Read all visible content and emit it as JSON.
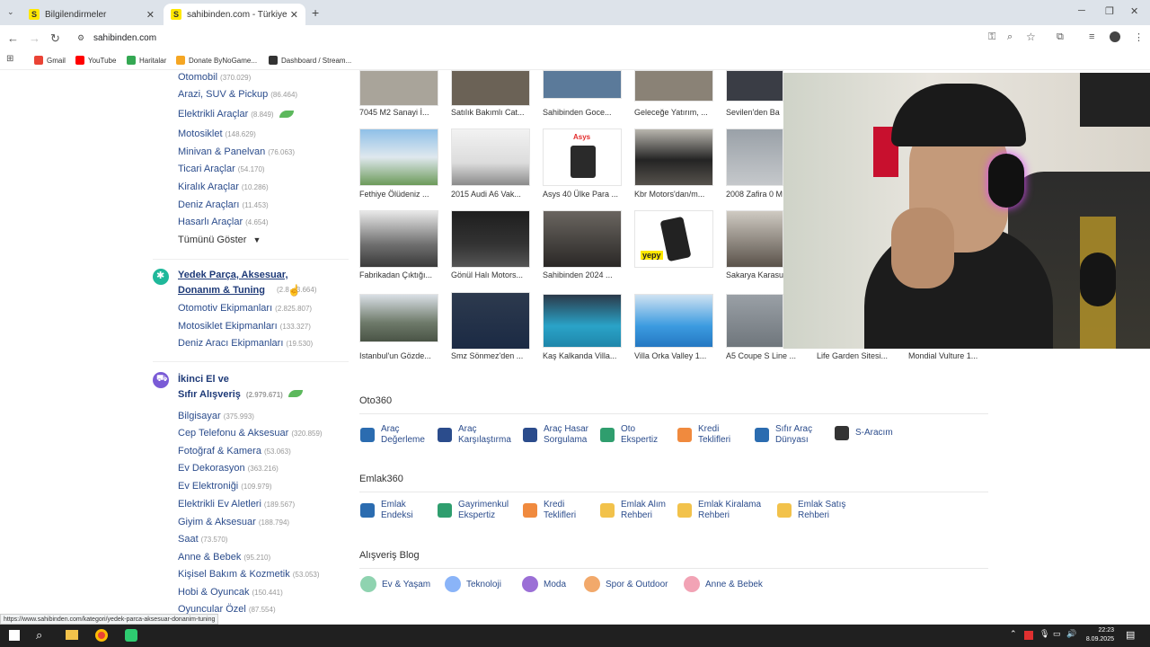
{
  "browser": {
    "tabs": [
      {
        "title": "Bilgilendirmeler",
        "favicon": "S"
      },
      {
        "title": "sahibinden.com - Türkiye'nin O",
        "favicon": "S"
      }
    ],
    "new_tab": "+",
    "url": "sahibinden.com",
    "bookmarks": [
      {
        "label": "Gmail",
        "color": "#ea4335"
      },
      {
        "label": "YouTube",
        "color": "#ff0000"
      },
      {
        "label": "Haritalar",
        "color": "#34a853"
      },
      {
        "label": "Donate ByNoGame...",
        "color": "#f5a623"
      },
      {
        "label": "Dashboard / Stream...",
        "color": "#333333"
      }
    ]
  },
  "vehicles": [
    {
      "name": "Otomobil",
      "count": "(370.029)"
    },
    {
      "name": "Arazi, SUV & Pickup",
      "count": "(86.464)"
    },
    {
      "name": "Elektrikli Araçlar",
      "count": "(8.849)"
    },
    {
      "name": "Motosiklet",
      "count": "(148.629)"
    },
    {
      "name": "Minivan & Panelvan",
      "count": "(76.063)"
    },
    {
      "name": "Ticari Araçlar",
      "count": "(54.170)"
    },
    {
      "name": "Kiralık Araçlar",
      "count": "(10.286)"
    },
    {
      "name": "Deniz Araçları",
      "count": "(11.453)"
    },
    {
      "name": "Hasarlı Araçlar",
      "count": "(4.654)"
    }
  ],
  "show_all": "Tümünü Göster",
  "parts_section": {
    "title_line1": "Yedek Parça, Aksesuar,",
    "title_line2": "Donanım & Tuning",
    "count": "(2.8",
    "count_tail": "3.664)",
    "items": [
      {
        "name": "Otomotiv Ekipmanları",
        "count": "(2.825.807)"
      },
      {
        "name": "Motosiklet Ekipmanları",
        "count": "(133.327)"
      },
      {
        "name": "Deniz Aracı Ekipmanları",
        "count": "(19.530)"
      }
    ]
  },
  "second_hand_section": {
    "title_line1": "İkinci El ve",
    "title_line2": "Sıfır Alışveriş",
    "count": "(2.979.671)",
    "items": [
      {
        "name": "Bilgisayar",
        "count": "(375.993)"
      },
      {
        "name": "Cep Telefonu & Aksesuar",
        "count": "(320.859)"
      },
      {
        "name": "Fotoğraf & Kamera",
        "count": "(53.063)"
      },
      {
        "name": "Ev Dekorasyon",
        "count": "(363.216)"
      },
      {
        "name": "Ev Elektroniği",
        "count": "(109.979)"
      },
      {
        "name": "Elektrikli Ev Aletleri",
        "count": "(189.567)"
      },
      {
        "name": "Giyim & Aksesuar",
        "count": "(188.794)"
      },
      {
        "name": "Saat",
        "count": "(73.570)"
      },
      {
        "name": "Anne & Bebek",
        "count": "(95.210)"
      },
      {
        "name": "Kişisel Bakım & Kozmetik",
        "count": "(53.053)"
      },
      {
        "name": "Hobi & Oyuncak",
        "count": "(150.441)"
      },
      {
        "name": "Oyuncular Özel",
        "count": "(87.554)"
      }
    ]
  },
  "showcase": [
    [
      "7045 M2 Sanayi İ...",
      "Satılık Bakımlı Cat...",
      "Sahibinden Goce...",
      "Geleceğe Yatırım, ...",
      "Sevilen'den Ba"
    ],
    [
      "Fethiye Ölüdeniz ...",
      "2015 Audi A6 Vak...",
      "Asys 40 Ülke Para ...",
      "Kbr Motors'dan/m...",
      "2008 Zafira 0 M"
    ],
    [
      "Fabrikadan Çıktığı...",
      "Gönül Halı Motors...",
      "Sahibinden 2024 ...",
      "",
      "Sakarya Karasu"
    ],
    [
      "Istanbul'un Gözde...",
      "Smz Sönmez'den ...",
      "Kaş Kalkanda Villa...",
      "Villa Orka Valley 1...",
      "A5 Coupe S Line ...",
      "Life Garden Sitesi...",
      "Mondial Vulture 1..."
    ]
  ],
  "showcase_brands": {
    "asys": "Asys",
    "yepy": "yepy"
  },
  "oto360": {
    "title": "Oto360",
    "items": [
      {
        "line1": "Araç",
        "line2": "Değerleme",
        "color": "#2b6cb0"
      },
      {
        "line1": "Araç",
        "line2": "Karşılaştırma",
        "color": "#2b4c8c"
      },
      {
        "line1": "Araç Hasar",
        "line2": "Sorgulama",
        "color": "#2b4c8c"
      },
      {
        "line1": "Oto",
        "line2": "Ekspertiz",
        "color": "#2f9e6e"
      },
      {
        "line1": "Kredi",
        "line2": "Teklifleri",
        "color": "#f08a3e"
      },
      {
        "line1": "Sıfır Araç",
        "line2": "Dünyası",
        "color": "#2b6cb0"
      },
      {
        "line1": "S-Aracım",
        "line2": "",
        "color": "#333333"
      }
    ]
  },
  "emlak360": {
    "title": "Emlak360",
    "items": [
      {
        "line1": "Emlak",
        "line2": "Endeksi",
        "color": "#2b6cb0"
      },
      {
        "line1": "Gayrimenkul",
        "line2": "Ekspertiz",
        "color": "#2f9e6e"
      },
      {
        "line1": "Kredi",
        "line2": "Teklifleri",
        "color": "#f08a3e"
      },
      {
        "line1": "Emlak Alım",
        "line2": "Rehberi",
        "color": "#f2c24b"
      },
      {
        "line1": "Emlak Kiralama",
        "line2": "Rehberi",
        "color": "#f2c24b"
      },
      {
        "line1": "Emlak Satış",
        "line2": "Rehberi",
        "color": "#f2c24b"
      }
    ]
  },
  "blog": {
    "title": "Alışveriş Blog",
    "items": [
      {
        "label": "Ev & Yaşam",
        "color": "#8fd3b0"
      },
      {
        "label": "Teknoloji",
        "color": "#8ab4f8"
      },
      {
        "label": "Moda",
        "color": "#9b6fd6"
      },
      {
        "label": "Spor & Outdoor",
        "color": "#f2a96b"
      },
      {
        "label": "Anne & Bebek",
        "color": "#f2a3b5"
      }
    ]
  },
  "status_url": "https://www.sahibinden.com/kategori/yedek-parca-aksesuar-donanim-tuning",
  "clock": {
    "time": "22:23",
    "date": "8.09.2025"
  }
}
